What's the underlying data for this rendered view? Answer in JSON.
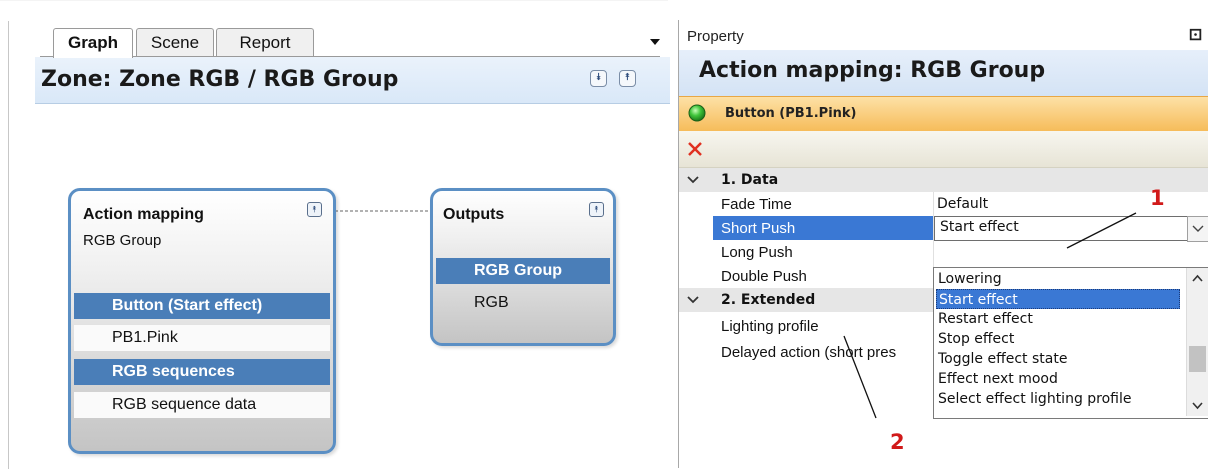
{
  "left": {
    "tabs": [
      {
        "label": "Graph"
      },
      {
        "label": "Scene"
      },
      {
        "label": "Report"
      }
    ],
    "zone_title": "Zone: Zone RGB / RGB Group",
    "nodes": {
      "action": {
        "title": "Action mapping",
        "subtitle": "RGB Group",
        "rows": [
          "Button (Start effect)",
          "PB1.Pink",
          "RGB sequences",
          "RGB sequence data"
        ]
      },
      "outputs": {
        "title": "Outputs",
        "rows": [
          "RGB Group",
          "RGB"
        ]
      }
    }
  },
  "right": {
    "panel_title": "Property",
    "pin_glyph": "⚀",
    "header": "Action mapping: RGB Group",
    "button_label": "Button (PB1.Pink)",
    "categories": [
      {
        "label": "1. Data"
      },
      {
        "label": "2. Extended"
      }
    ],
    "properties": [
      {
        "name": "Fade Time",
        "value": "Default"
      },
      {
        "name": "Short Push",
        "value": "Start effect"
      },
      {
        "name": "Long Push",
        "value": ""
      },
      {
        "name": "Double Push",
        "value": ""
      },
      {
        "name": "Lighting profile",
        "value": ""
      },
      {
        "name": "Delayed action (short pres",
        "value": ""
      }
    ],
    "dropdown_options": [
      "Lowering",
      "Start effect",
      "Restart effect",
      "Stop effect",
      "Toggle effect state",
      "Effect next mood",
      "Select effect lighting profile"
    ],
    "selected_option": "Start effect"
  },
  "annotations": [
    "1",
    "2"
  ],
  "colors": {
    "node_border": "#5b8fc4",
    "row_highlight": "#4a7eb8",
    "selection": "#3a78d4",
    "button_bar": "#f6bc5a",
    "annotation": "#d11a1a"
  }
}
